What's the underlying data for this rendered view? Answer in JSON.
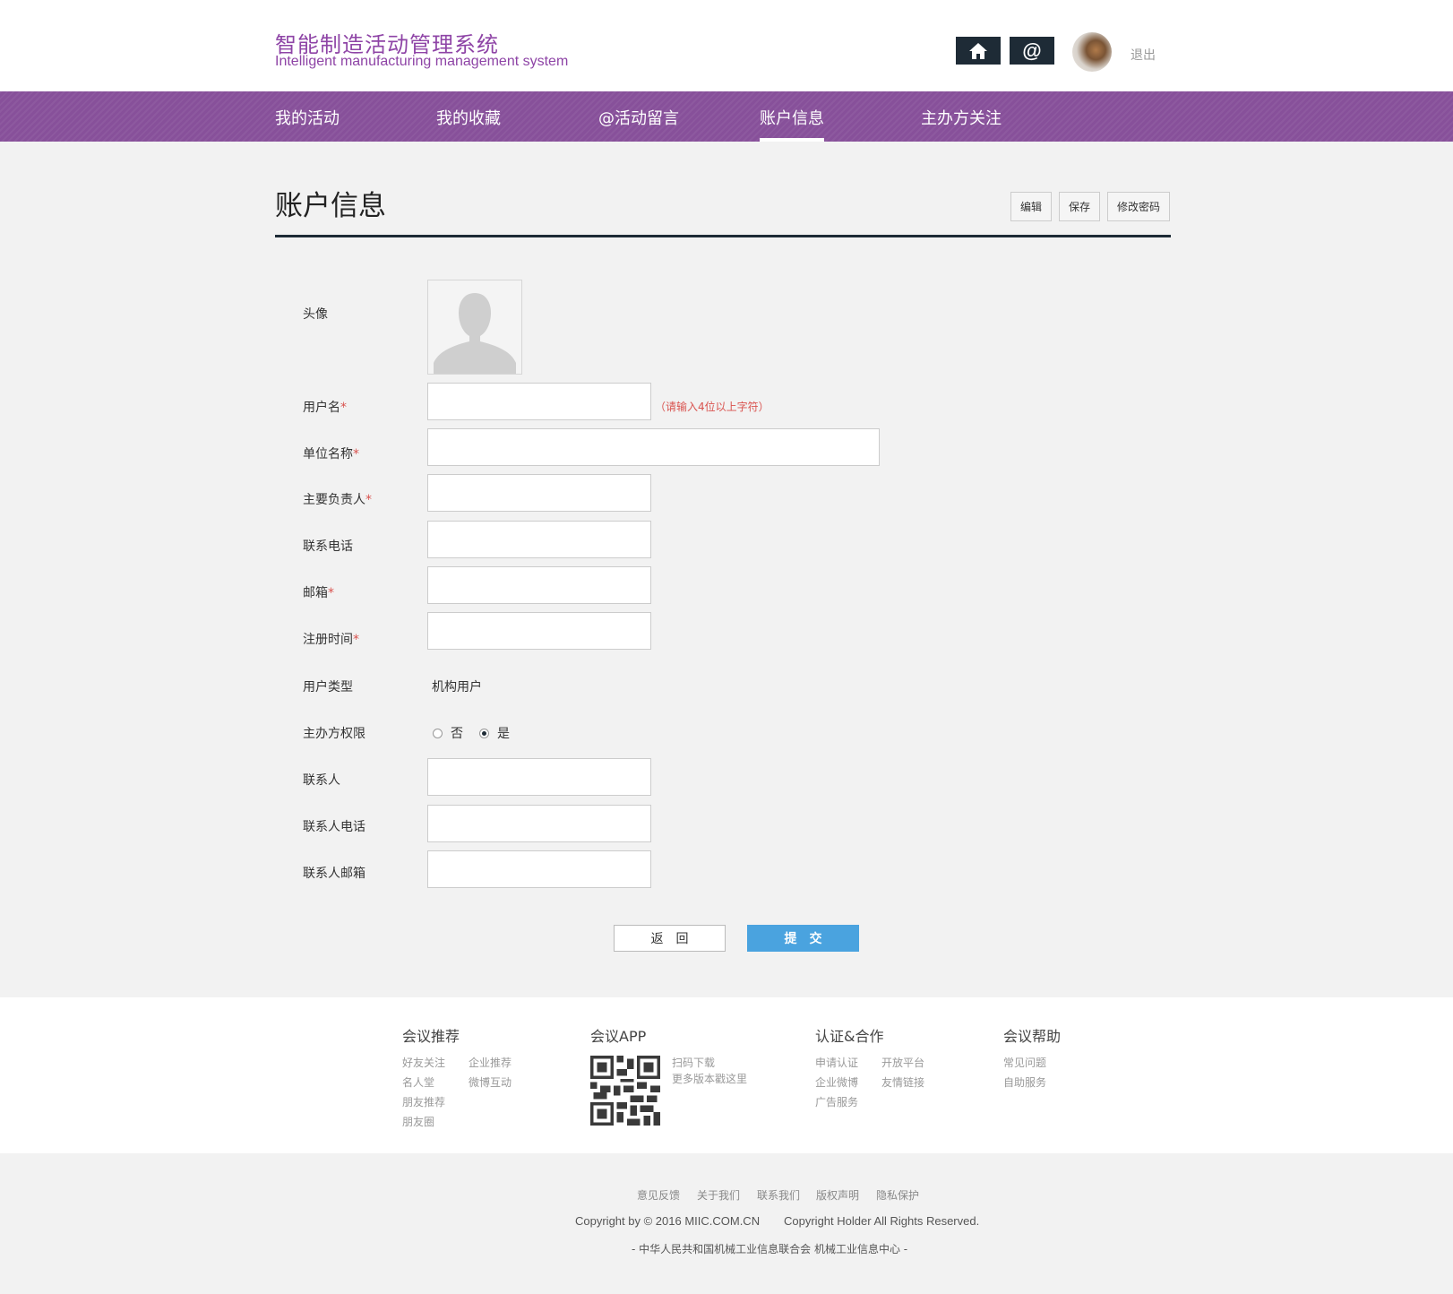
{
  "header": {
    "brand_cn": "智能制造活动管理系统",
    "brand_en": "Intelligent manufacturing management system",
    "at_label": "@",
    "logout": "退出"
  },
  "nav": {
    "items": [
      {
        "label": "我的活动"
      },
      {
        "label": "我的收藏"
      },
      {
        "label": "@活动留言"
      },
      {
        "label": "账户信息",
        "active": true
      },
      {
        "label": "主办方关注"
      }
    ]
  },
  "page": {
    "title": "账户信息",
    "actions": {
      "edit": "编辑",
      "save": "保存",
      "change_password": "修改密码"
    }
  },
  "form": {
    "avatar_label": "头像",
    "username": {
      "label": "用户名",
      "required_mark": "*",
      "value": "",
      "hint": "（请输入4位以上字符）"
    },
    "org_name": {
      "label": "单位名称",
      "required_mark": "*",
      "value": ""
    },
    "principal": {
      "label": "主要负责人",
      "required_mark": "*",
      "value": ""
    },
    "phone": {
      "label": "联系电话",
      "value": ""
    },
    "email": {
      "label": "邮箱",
      "required_mark": "*",
      "value": ""
    },
    "register_time": {
      "label": "注册时间",
      "required_mark": "*",
      "value": ""
    },
    "user_type": {
      "label": "用户类型",
      "value": "机构用户"
    },
    "host_permission": {
      "label": "主办方权限",
      "option_no": "否",
      "option_yes": "是",
      "selected": "是"
    },
    "contact": {
      "label": "联系人",
      "value": ""
    },
    "contact_phone": {
      "label": "联系人电话",
      "value": ""
    },
    "contact_email": {
      "label": "联系人邮箱",
      "value": ""
    },
    "back_button": "返回",
    "submit_button": "提交"
  },
  "footer": {
    "recommend": {
      "title": "会议推荐",
      "links": [
        "好友关注",
        "企业推荐",
        "名人堂",
        "微博互动",
        "朋友推荐",
        "朋友圈"
      ]
    },
    "app": {
      "title": "会议APP",
      "scan": "扫码下载",
      "more": "更多版本戳这里"
    },
    "cooperation": {
      "title": "认证&合作",
      "links": [
        "申请认证",
        "开放平台",
        "企业微博",
        "友情链接",
        "广告服务"
      ]
    },
    "help": {
      "title": "会议帮助",
      "links": [
        "常见问题",
        "自助服务"
      ]
    },
    "bottom_links": [
      "意见反馈",
      "关于我们",
      "联系我们",
      "版权声明",
      "隐私保护"
    ],
    "copyright_left": "Copyright by © 2016 MIIC.COM.CN",
    "copyright_right": "Copyright Holder All Rights Reserved.",
    "org_line": "-  中华人民共和国机械工业信息联合会    机械工业信息中心  -"
  },
  "colors": {
    "brand_purple": "#8e44a6",
    "nav_purple": "#87509a",
    "dark": "#1e2b36",
    "submit_blue": "#4aa3df",
    "required_red": "#d9534f"
  },
  "icons": {
    "home": "home-icon",
    "avatar_placeholder": "user-silhouette-icon",
    "qr": "qr-code-icon"
  }
}
